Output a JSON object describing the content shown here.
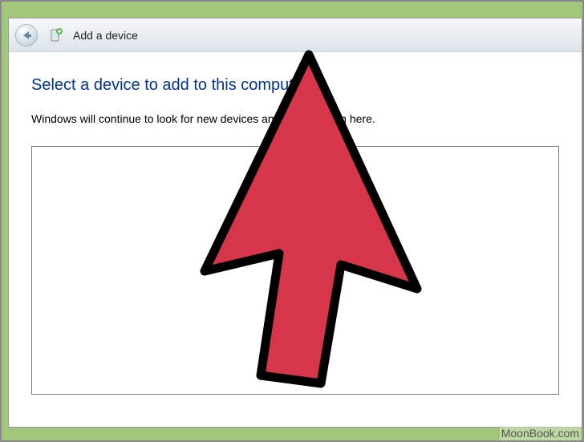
{
  "titlebar": {
    "title": "Add a device"
  },
  "content": {
    "heading": "Select a device to add to this computer",
    "description": "Windows will continue to look for new devices and display them here."
  },
  "watermark": "MoonBook.com"
}
